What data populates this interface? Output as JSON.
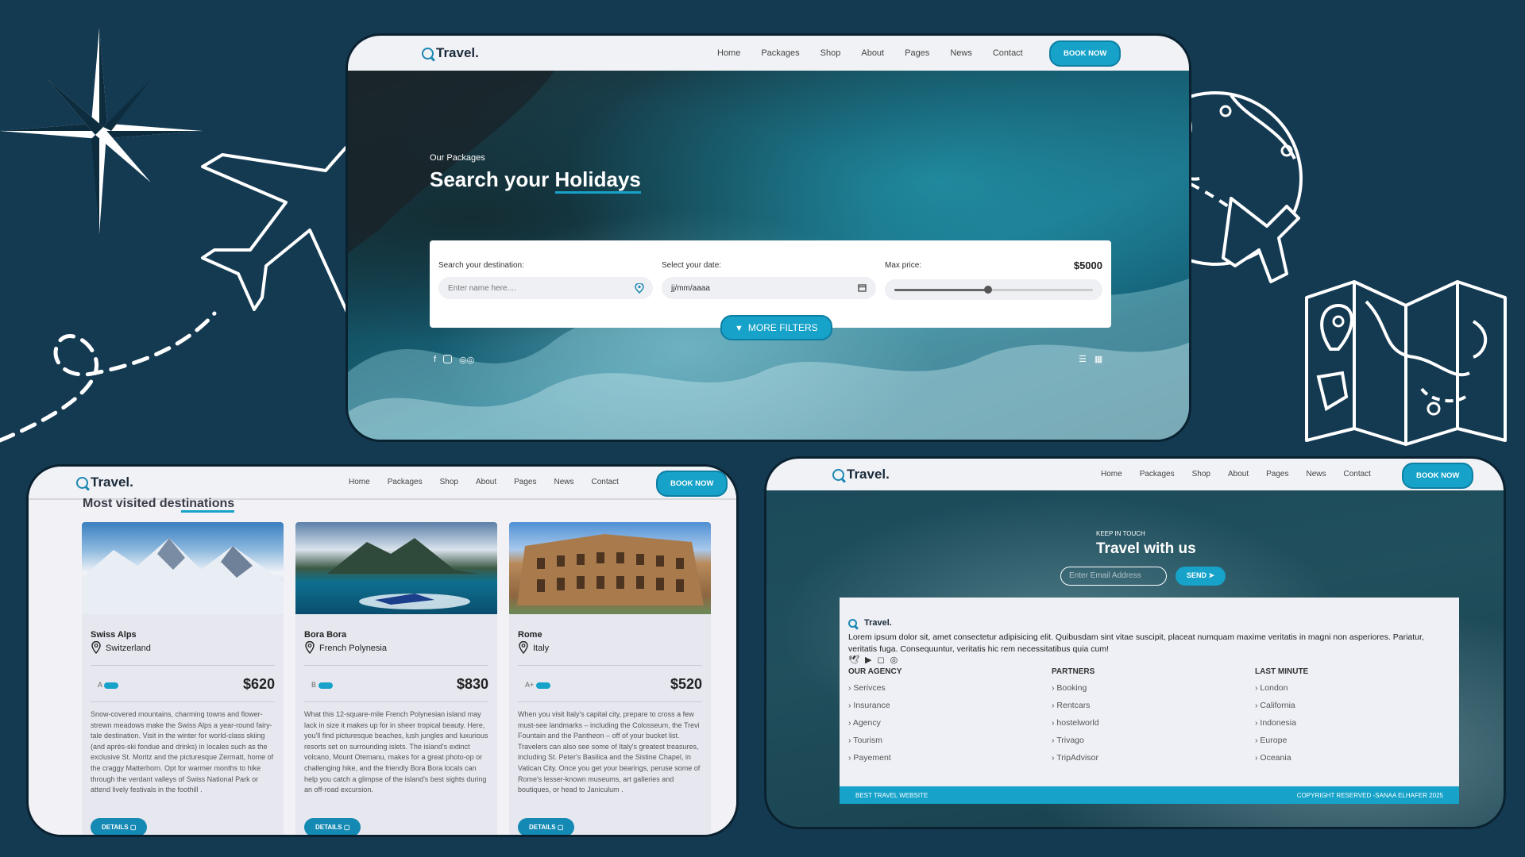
{
  "brand": "Travel.",
  "nav": {
    "items": [
      "Home",
      "Packages",
      "Shop",
      "About",
      "Pages",
      "News",
      "Contact"
    ],
    "book_now": "BOOK NOW"
  },
  "hero": {
    "eyebrow": "Our Packages",
    "title_part1": "Search your ",
    "title_part2": "Holidays",
    "search": {
      "destination_label": "Search your destination:",
      "destination_placeholder": "Enter name here....",
      "date_label": "Select your date:",
      "date_value": "jj/mm/aaaa",
      "price_label": "Max price:",
      "price_value": "$5000",
      "price_fraction": 0.47
    },
    "more_filters": "MORE FILTERS"
  },
  "destinations": {
    "heading_part1": "Most visited des",
    "heading_part2": "tinations",
    "cards": [
      {
        "name": "Swiss Alps",
        "location": "Switzerland",
        "grade": "A",
        "price": "$620",
        "details": "DETAILS",
        "description": "Snow-covered mountains, charming towns and flower-strewn meadows make the Swiss Alps a year-round fairy-tale destination. Visit in the winter for world-class skiing (and après-ski fondue and drinks) in locales such as the exclusive St. Moritz and the picturesque Zermatt, home of the craggy Matterhorn. Opt for warmer months to hike through the verdant valleys of Swiss National Park or attend lively festivals in the foothill ."
      },
      {
        "name": "Bora Bora",
        "location": "French Polynesia",
        "grade": "B",
        "price": "$830",
        "details": "DETAILS",
        "description": "What this 12-square-mile French Polynesian island may lack in size it makes up for in sheer tropical beauty. Here, you'll find picturesque beaches, lush jungles and luxurious resorts set on surrounding islets. The island's extinct volcano, Mount Otemanu, makes for a great photo-op or challenging hike, and the friendly Bora Bora locals can help you catch a glimpse of the island's best sights during an off-road excursion."
      },
      {
        "name": "Rome",
        "location": "Italy",
        "grade": "A+",
        "price": "$520",
        "details": "DETAILS",
        "description": "When you visit Italy's capital city, prepare to cross a few must-see landmarks – including the Colosseum, the Trevi Fountain and the Pantheon – off of your bucket list. Travelers can also see some of Italy's greatest treasures, including St. Peter's Basilica and the Sistine Chapel, in Vatican City. Once you get your bearings, peruse some of Rome's lesser-known museums, art galleries and boutiques, or head to Janiculum ."
      }
    ]
  },
  "contact": {
    "eyebrow": "KEEP IN TOUCH",
    "title": "Travel with us",
    "email_placeholder": "Enter Email Address",
    "send": "SEND"
  },
  "footer": {
    "brand": "Travel.",
    "about": "Lorem ipsum dolor sit, amet consectetur adipisicing elit. Quibusdam sint vitae suscipit, placeat numquam maxime veritatis in magni non asperiores. Pariatur, veritatis fuga. Consequuntur, veritatis hic rem necessitatibus quia cum!",
    "columns": [
      {
        "title": "OUR AGENCY",
        "items": [
          "Serivces",
          "Insurance",
          "Agency",
          "Tourism",
          "Payement"
        ]
      },
      {
        "title": "PARTNERS",
        "items": [
          "Booking",
          "Rentcars",
          "hostelworld",
          "Trivago",
          "TripAdvisor"
        ]
      },
      {
        "title": "LAST MINUTE",
        "items": [
          "London",
          "California",
          "Indonesia",
          "Europe",
          "Oceania"
        ]
      }
    ],
    "bottom_left": "BEST TRAVEL WEBSITE",
    "bottom_right": "COPYRIGHT RESERVED -SANAA ELHAFER 2025"
  },
  "colors": {
    "background": "#143a52",
    "accent": "#16a2c9",
    "nav_bg": "#f1f2f6"
  }
}
